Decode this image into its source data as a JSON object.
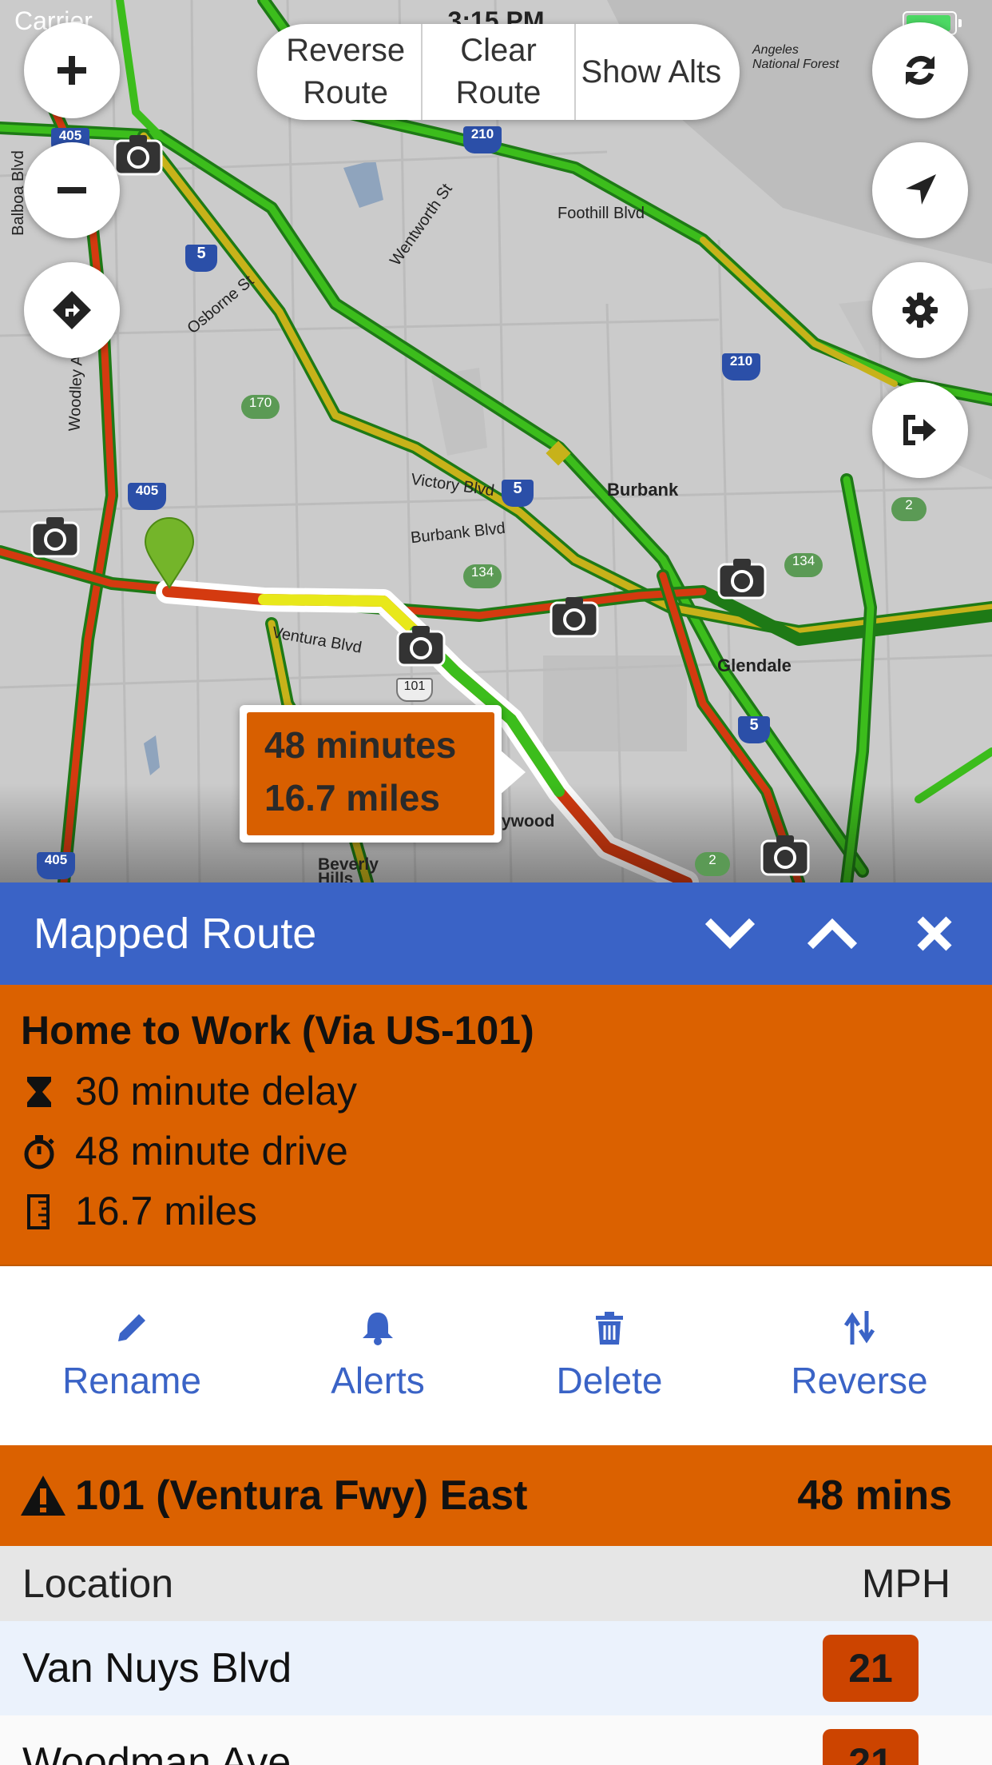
{
  "status_bar": {
    "carrier": "Carrier",
    "time": "3:15 PM"
  },
  "map_controls": {
    "segments": {
      "reverse_route": "Reverse Route",
      "clear_route": "Clear Route",
      "show_alts": "Show Alts"
    },
    "left_buttons": [
      "plus-icon",
      "minus-icon",
      "directions-icon"
    ],
    "right_buttons": [
      "refresh-icon",
      "location-arrow-icon",
      "gear-icon",
      "sign-out-icon"
    ]
  },
  "map_labels": {
    "cities": {
      "burbank": "Burbank",
      "glendale": "Glendale",
      "hollywood": "ywood",
      "beverly_hills_1": "Beverly",
      "beverly_hills_2": "Hills",
      "angeles_forest_1": "Angeles",
      "angeles_forest_2": "National Forest"
    },
    "streets": {
      "foothill": "Foothill Blvd",
      "victory": "Victory Blvd",
      "burbank_blvd": "Burbank Blvd",
      "ventura": "Ventura Blvd",
      "osborne": "Osborne St",
      "wentworth": "Wentworth St",
      "balboa": "Balboa Blvd",
      "woodley": "Woodley Ave"
    },
    "shields": {
      "i5a": "5",
      "i5b": "5",
      "i5c": "5",
      "i405a": "405",
      "i405b": "405",
      "i405c": "405",
      "i210a": "210",
      "i210b": "210",
      "ca170": "170",
      "ca134a": "134",
      "ca134b": "134",
      "ca2a": "2",
      "ca2b": "2",
      "us101": "101"
    }
  },
  "route_callout": {
    "duration": "48 minutes",
    "distance": "16.7 miles",
    "color": "#d85f00"
  },
  "panel": {
    "title": "Mapped Route",
    "accent_color": "#3a63c6",
    "header_buttons": [
      "chevron-down-icon",
      "chevron-up-icon",
      "close-icon"
    ]
  },
  "route_summary": {
    "name": "Home to Work (Via US-101)",
    "delay": "30 minute delay",
    "drive": "48 minute drive",
    "distance": "16.7 miles",
    "background_color": "#db6100"
  },
  "actions": [
    {
      "label": "Rename",
      "icon": "pencil-icon"
    },
    {
      "label": "Alerts",
      "icon": "bell-icon"
    },
    {
      "label": "Delete",
      "icon": "trash-icon"
    },
    {
      "label": "Reverse",
      "icon": "reverse-arrows-icon"
    }
  ],
  "road_segment": {
    "name": "101 (Ventura Fwy) East",
    "time": "48 mins",
    "columns": {
      "location": "Location",
      "mph": "MPH"
    },
    "rows": [
      {
        "location": "Van Nuys Blvd",
        "mph": "21"
      },
      {
        "location": "Woodman Ave",
        "mph": "21"
      }
    ]
  }
}
